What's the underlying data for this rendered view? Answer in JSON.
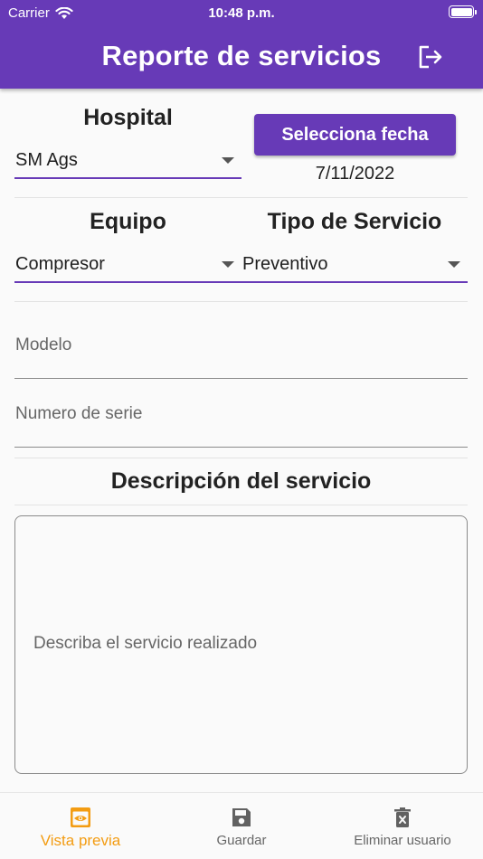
{
  "status_bar": {
    "carrier": "Carrier",
    "time": "10:48 p.m."
  },
  "header": {
    "title": "Reporte de servicios",
    "logout_icon": "logout-icon",
    "color": "#673ab7"
  },
  "hospital": {
    "label": "Hospital",
    "value": "SM Ags"
  },
  "date": {
    "button_label": "Selecciona fecha",
    "value": "7/11/2022"
  },
  "equipo": {
    "label": "Equipo",
    "value": "Compresor"
  },
  "tipo_servicio": {
    "label": "Tipo de Servicio",
    "value": "Preventivo"
  },
  "modelo": {
    "placeholder": "Modelo"
  },
  "numero_serie": {
    "placeholder": "Numero de serie"
  },
  "descripcion": {
    "heading": "Descripción del servicio",
    "placeholder": "Describa el servicio realizado"
  },
  "bottom_nav": {
    "items": [
      {
        "label": "Vista previa",
        "icon": "preview-icon",
        "active": true
      },
      {
        "label": "Guardar",
        "icon": "save-icon",
        "active": false
      },
      {
        "label": "Eliminar usuario",
        "icon": "delete-icon",
        "active": false
      }
    ],
    "active_color": "#f39c12"
  }
}
